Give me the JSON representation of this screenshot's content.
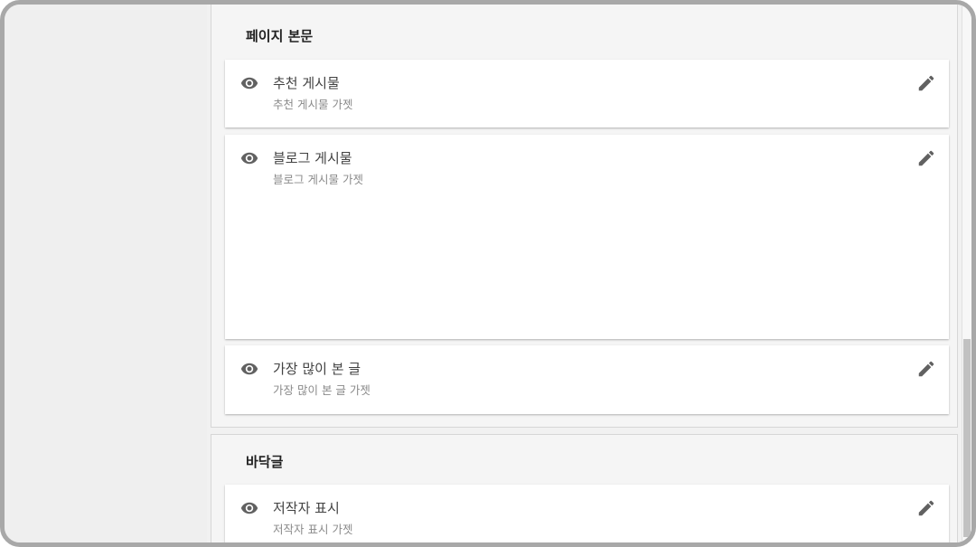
{
  "sections": [
    {
      "title": "페이지 본문",
      "widgets": [
        {
          "title": "추천 게시물",
          "subtitle": "추천 게시물 가젯"
        },
        {
          "title": "블로그 게시물",
          "subtitle": "블로그 게시물 가젯"
        },
        {
          "title": "가장 많이 본 글",
          "subtitle": "가장 많이 본 글 가젯"
        }
      ]
    },
    {
      "title": "바닥글",
      "widgets": [
        {
          "title": "저작자 표시",
          "subtitle": "저작자 표시 가젯"
        }
      ]
    }
  ],
  "icons": {
    "visibility": "eye-icon",
    "edit": "pencil-icon"
  },
  "colors": {
    "icon": "#616161",
    "section_bg": "#f5f5f5",
    "card_bg": "#ffffff"
  }
}
